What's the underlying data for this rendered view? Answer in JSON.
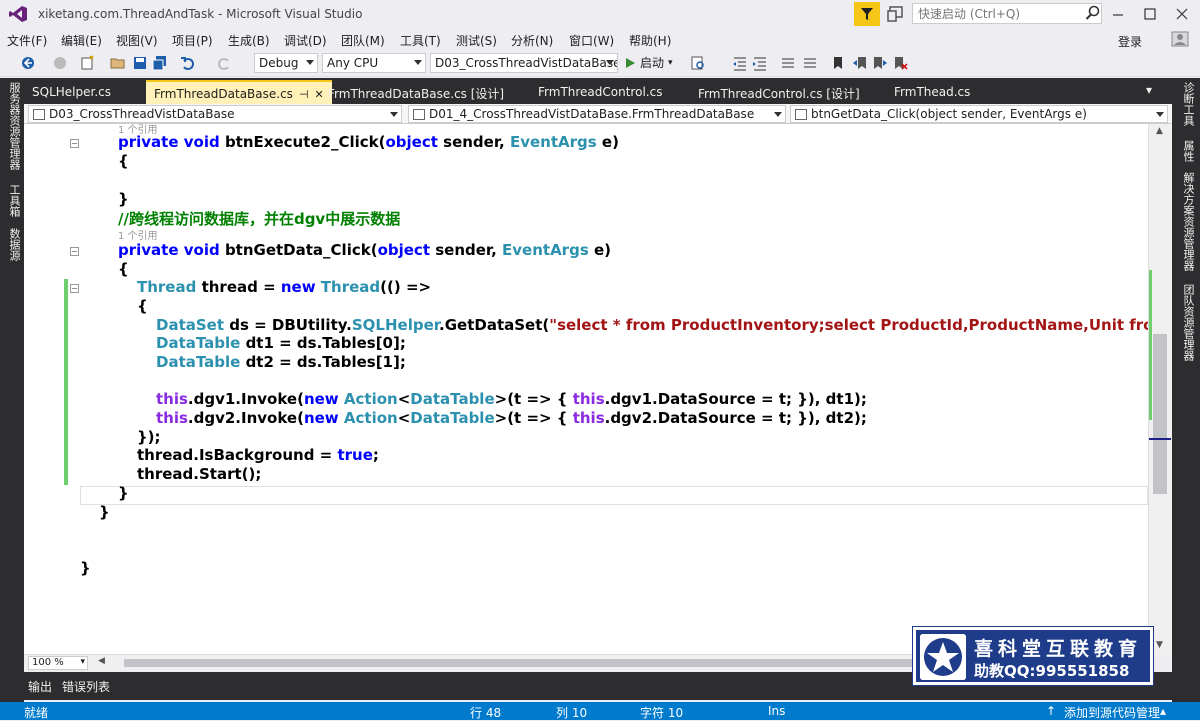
{
  "window": {
    "title": "xiketang.com.ThreadAndTask - Microsoft Visual Studio",
    "quick_launch_placeholder": "快速启动 (Ctrl+Q)"
  },
  "menu": {
    "items": [
      "文件(F)",
      "编辑(E)",
      "视图(V)",
      "项目(P)",
      "生成(B)",
      "调试(D)",
      "团队(M)",
      "工具(T)",
      "测试(S)",
      "分析(N)",
      "窗口(W)",
      "帮助(H)"
    ],
    "login": "登录"
  },
  "toolbar": {
    "config": "Debug",
    "platform": "Any CPU",
    "project": "D03_CrossThreadVistDataBase",
    "start": "启动"
  },
  "left_sidebar": [
    "服务器资源管理器",
    "工具箱",
    "数据源"
  ],
  "right_sidebar": [
    "诊断工具",
    "属性",
    "解决方案资源管理器",
    "团队资源管理器"
  ],
  "tabs": [
    {
      "label": "SQLHelper.cs"
    },
    {
      "label": "FrmThreadDataBase.cs",
      "active": true
    },
    {
      "label": "FrmThreadDataBase.cs [设计]"
    },
    {
      "label": "FrmThreadControl.cs"
    },
    {
      "label": "FrmThreadControl.cs [设计]"
    },
    {
      "label": "FrmThead.cs"
    }
  ],
  "nav": {
    "project": "D03_CrossThreadVistDataBase",
    "class": "D01_4_CrossThreadVistDataBase.FrmThreadDataBase",
    "member": "btnGetData_Click(object sender, EventArgs e)"
  },
  "code": {
    "ref_top": "1 个引用",
    "l_exec_sig": {
      "kw": "private void",
      "name": " btnExecute2_Click(",
      "obj": "object",
      "mid": " sender, ",
      "ty": "EventArgs",
      "end": " e)"
    },
    "l_brace_open_1": "{",
    "l_brace_close_1": "}",
    "l_comment": "//跨线程访问数据库，并在dgv中展示数据",
    "ref_mid": "1 个引用",
    "l_get_sig": {
      "kw": "private void",
      "name": " btnGetData_Click(",
      "obj": "object",
      "mid": " sender, ",
      "ty": "EventArgs",
      "end": " e)"
    },
    "l_brace_open_2": "{",
    "l_thread": {
      "ty": "Thread",
      "a": " thread = ",
      "kw": "new",
      "ty2": " Thread",
      "b": "(() =>"
    },
    "l_brace_open_3": "{",
    "l_dataset": {
      "ty": "DataSet",
      "a": " ds = DBUtility.",
      "ty2": "SQLHelper",
      "b": ".GetDataSet(",
      "st": "\"select * from ProductInventory;select ProductId,ProductName,Unit from Pr"
    },
    "l_dt1": {
      "ty": "DataTable",
      "a": " dt1 = ds.Tables[0];"
    },
    "l_dt2": {
      "ty": "DataTable",
      "a": " dt2 = ds.Tables[1];"
    },
    "l_invoke1": {
      "th": "this",
      "a": ".dgv1.Invoke(",
      "kw": "new",
      "ty": " Action",
      "b": "<",
      "ty2": "DataTable",
      "c": ">(t => { ",
      "th2": "this",
      "d": ".dgv1.DataSource = t; }), dt1);"
    },
    "l_invoke2": {
      "th": "this",
      "a": ".dgv2.Invoke(",
      "kw": "new",
      "ty": " Action",
      "b": "<",
      "ty2": "DataTable",
      "c": ">(t => { ",
      "th2": "this",
      "d": ".dgv2.DataSource = t; }), dt2);"
    },
    "l_close_lambda": "});",
    "l_isbg": {
      "a": "thread.IsBackground = ",
      "kw": "true",
      "b": ";"
    },
    "l_start": "thread.Start();",
    "l_brace_close_2": "}",
    "l_brace_close_3": "}",
    "l_brace_close_4": "}"
  },
  "zoom": "100 %",
  "bottom_tabs": [
    "输出",
    "错误列表"
  ],
  "status": {
    "ready": "就绪",
    "line": "行 48",
    "col": "列 10",
    "char": "字符 10",
    "ins": "Ins",
    "source_control": "添加到源代码管理"
  },
  "watermark": {
    "name": "喜科堂互联教育",
    "qq": "助教QQ:995551858"
  },
  "colors": {
    "accent": "#007acc",
    "active_tab": "#fff1b8",
    "keyword": "#0000ff",
    "type": "#2b91af",
    "string": "#a31515",
    "comment": "#008000"
  }
}
